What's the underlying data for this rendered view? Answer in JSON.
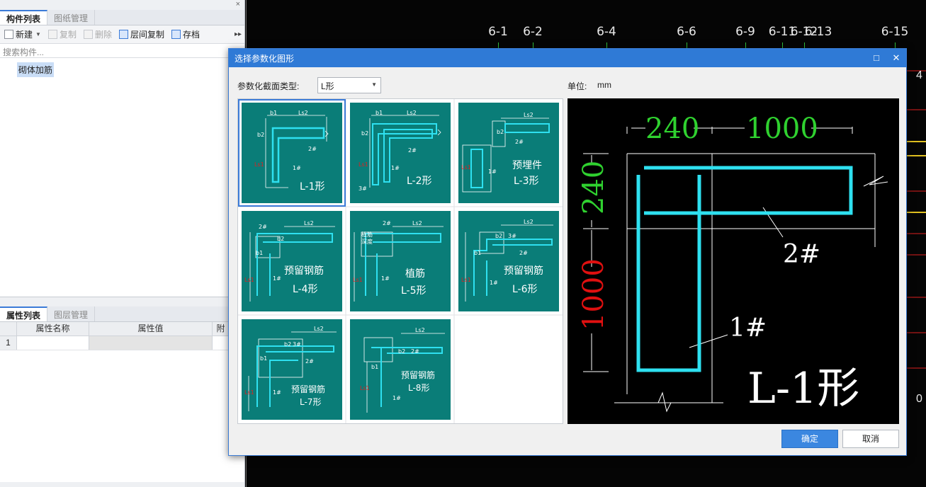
{
  "left_panel": {
    "close": "×",
    "tabs": [
      "构件列表",
      "图纸管理"
    ],
    "toolbar": {
      "new": "新建",
      "copy": "复制",
      "delete": "删除",
      "floor_copy": "层间复制",
      "save": "存档",
      "more": "▸▸"
    },
    "search_placeholder": "搜索构件...",
    "tree_item": "砌体加筋",
    "prop_tabs": [
      "属性列表",
      "图层管理"
    ],
    "grid_headers": [
      "属性名称",
      "属性值",
      "附"
    ],
    "grid_rows": [
      "1"
    ]
  },
  "canvas": {
    "axis_labels": [
      "6-1",
      "6-2",
      "6-4",
      "6-6",
      "6-9",
      "6-11",
      "6-12",
      "6-13",
      "6-15"
    ],
    "right_text": "4",
    "right_text2": "0"
  },
  "dialog": {
    "title": "选择参数化图形",
    "section_type_label": "参数化截面类型:",
    "section_type_value": "L形",
    "unit_label": "单位:",
    "unit_value": "mm",
    "thumbs": [
      {
        "name": "L-1形",
        "extra": ""
      },
      {
        "name": "L-2形",
        "extra": ""
      },
      {
        "name": "L-3形",
        "extra": "预埋件"
      },
      {
        "name": "L-4形",
        "extra": "预留钢筋"
      },
      {
        "name": "L-5形",
        "extra": "植筋"
      },
      {
        "name": "L-6形",
        "extra": "预留钢筋"
      },
      {
        "name": "L-7形",
        "extra": "预留钢筋"
      },
      {
        "name": "L-8形",
        "extra": "预留钢筋"
      }
    ],
    "preview": {
      "dim_top_left": "240",
      "dim_top_right": "1000",
      "dim_left_top": "240",
      "dim_left_bottom": "1000",
      "bar2": "2#",
      "bar1": "1#",
      "shape_name": "L-1形"
    },
    "ok": "确定",
    "cancel": "取消"
  },
  "colors": {
    "accent": "#2f7ad6",
    "thumb_bg": "#0a7d78",
    "rebar": "#2ee0f0",
    "dim_green": "#2fd12f",
    "dim_red": "#e01010"
  }
}
